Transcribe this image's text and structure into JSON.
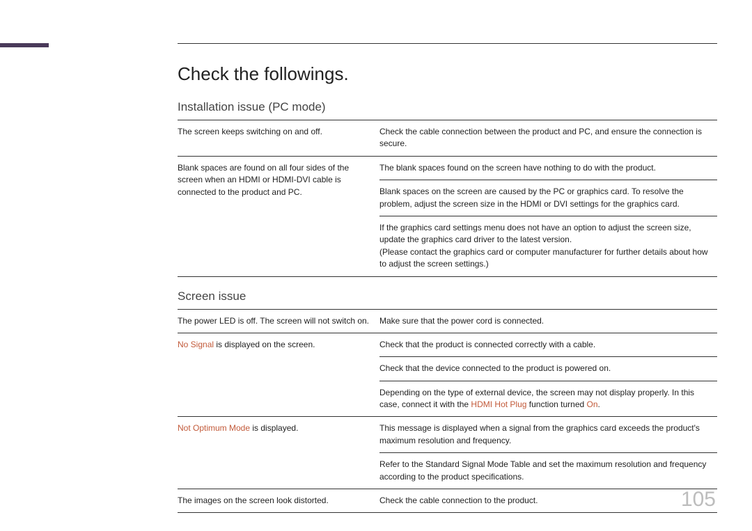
{
  "page_number": "105",
  "main_title": "Check the followings.",
  "section1": {
    "title": "Installation issue (PC mode)",
    "r1_left": "The screen keeps switching on and off.",
    "r1_right": "Check the cable connection between the product and PC, and ensure the connection is secure.",
    "r2_left": "Blank spaces are found on all four sides of the screen when an HDMI or HDMI-DVI cable is connected to the product and PC.",
    "r2_right_a": "The blank spaces found on the screen have nothing to do with the product.",
    "r2_right_b": "Blank spaces on the screen are caused by the PC or graphics card. To resolve the problem, adjust the screen size in the HDMI or DVI settings for the graphics card.",
    "r2_right_c1": "If the graphics card settings menu does not have an option to adjust the screen size, update the graphics card driver to the latest version.",
    "r2_right_c2": "(Please contact the graphics card or computer manufacturer for further details about how to adjust the screen settings.)"
  },
  "section2": {
    "title": "Screen issue",
    "r1_left": "The power LED is off. The screen will not switch on.",
    "r1_right": "Make sure that the power cord is connected.",
    "r2_kw": "No Signal",
    "r2_left_rest": " is displayed on the screen.",
    "r2_right_a": "Check that the product is connected correctly with a cable.",
    "r2_right_b": "Check that the device connected to the product is powered on.",
    "r2_right_c_pre": "Depending on the type of external device, the screen may not display properly. In this case, connect it with the ",
    "r2_right_c_kw1": "HDMI Hot Plug",
    "r2_right_c_mid": " function turned ",
    "r2_right_c_kw2": "On",
    "r2_right_c_post": ".",
    "r3_kw": "Not Optimum Mode",
    "r3_left_rest": " is displayed.",
    "r3_right_a": "This message is displayed when a signal from the graphics card exceeds the product's maximum resolution and frequency.",
    "r3_right_b": "Refer to the Standard Signal Mode Table and set the maximum resolution and frequency according to the product specifications.",
    "r4_left": "The images on the screen look distorted.",
    "r4_right": "Check the cable connection to the product."
  }
}
